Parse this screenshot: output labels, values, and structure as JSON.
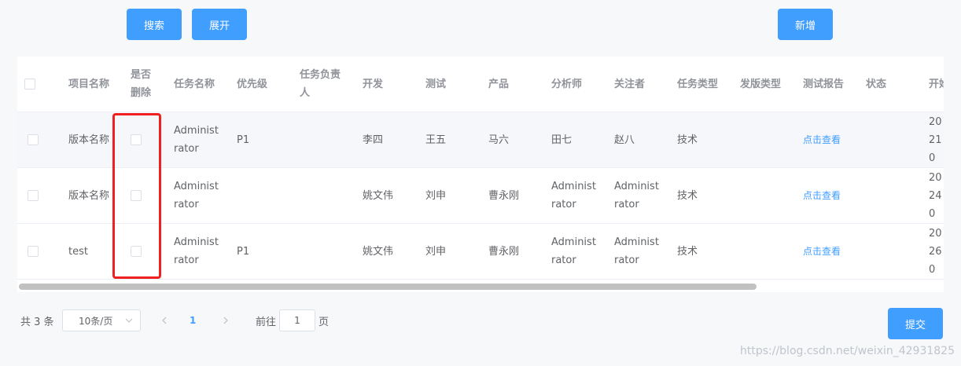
{
  "toolbar": {
    "search_label": "搜索",
    "expand_label": "展开",
    "add_label": "新增"
  },
  "table": {
    "columns": [
      "项目名称",
      "是否删除",
      "任务名称",
      "优先级",
      "任务负责人",
      "开发",
      "测试",
      "产品",
      "分析师",
      "关注者",
      "任务类型",
      "发版类型",
      "测试报告",
      "状态",
      "开始"
    ],
    "rows": [
      {
        "project": "版本名称",
        "task": "Administrator",
        "priority": "P1",
        "dev": "李四",
        "test": "王五",
        "product": "马六",
        "analyst": "田七",
        "follower": "赵八",
        "type": "技术",
        "report": "点击查看",
        "start": "2021 0"
      },
      {
        "project": "版本名称",
        "task": "Administrator",
        "priority": "",
        "dev": "姚文伟",
        "test": "刘申",
        "product": "曹永刚",
        "analyst": "Administrator",
        "follower": "Administrator",
        "type": "技术",
        "report": "点击查看",
        "start": "2024 0"
      },
      {
        "project": "test",
        "task": "Administrator",
        "priority": "P1",
        "dev": "姚文伟",
        "test": "刘申",
        "product": "曹永刚",
        "analyst": "Administrator",
        "follower": "Administrator",
        "type": "技术",
        "report": "点击查看",
        "start": "2026 0"
      }
    ]
  },
  "pagination": {
    "total": "共 3 条",
    "page_size": "10条/页",
    "current_page": "1",
    "goto_prefix": "前往",
    "goto_value": "1",
    "goto_suffix": "页"
  },
  "submit_label": "提交",
  "watermark": "https://blog.csdn.net/weixin_42931825",
  "colors": {
    "primary": "#409eff",
    "highlight": "#f02020",
    "row_hover": "#f5f7fa"
  }
}
